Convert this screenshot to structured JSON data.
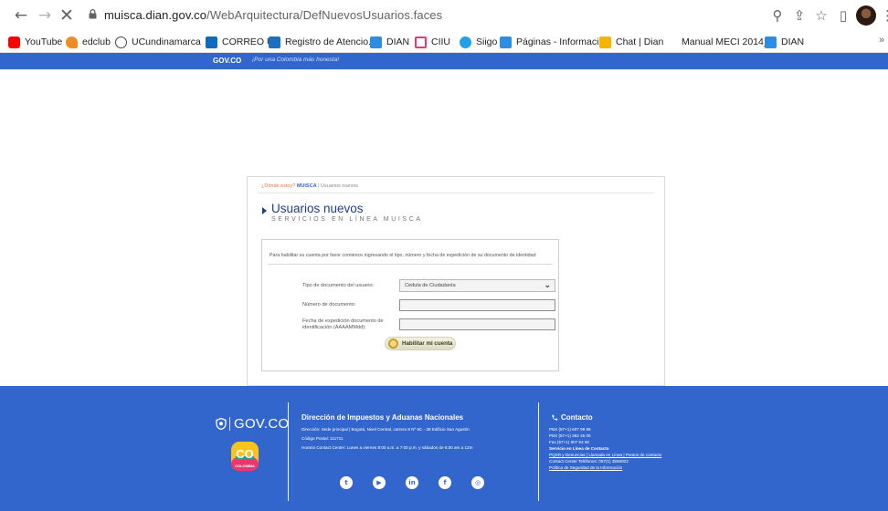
{
  "browser": {
    "url_host": "muisca.dian.gov.co",
    "url_path": "/WebArquitectura/DefNuevosUsuarios.faces",
    "icons": [
      "back-icon",
      "forward-icon",
      "close-icon",
      "lock-icon",
      "zoom-icon",
      "share-icon",
      "star-icon",
      "sidepanel-icon",
      "profile-avatar",
      "menu-icon"
    ]
  },
  "bookmarks": [
    {
      "label": "YouTube",
      "color": "#ff0000"
    },
    {
      "label": "edclub",
      "color": "#f08a24"
    },
    {
      "label": "UCundinamarca",
      "color": "#444444"
    },
    {
      "label": "CORREO U",
      "color": "#0f6cbd"
    },
    {
      "label": "Registro de Atencio...",
      "color": "#1f6fbf"
    },
    {
      "label": "DIAN",
      "color": "#2d8de0"
    },
    {
      "label": "CIIU",
      "color": "#e8386d"
    },
    {
      "label": "Siigo",
      "color": "#23a0e8"
    },
    {
      "label": "Páginas - Informaci...",
      "color": "#2d8de0"
    },
    {
      "label": "Chat | Dian",
      "color": "#f5b400"
    },
    {
      "label": "Manual MECI 2014_...",
      "color": ""
    },
    {
      "label": "DIAN",
      "color": "#2d8de0"
    }
  ],
  "bookmarks_more": "»",
  "govbar": {
    "badge": "GOV.CO",
    "slogan": "¡Por una Colombia más honesta!"
  },
  "panel": {
    "breadcrumb_prefix": "¿Dónde estoy?",
    "breadcrumb_home": "MUISCA",
    "breadcrumb_sep": " | ",
    "breadcrumb_current": "Usuarios nuevos",
    "title": "Usuarios nuevos",
    "subtitle": "SERVICIOS EN LÍNEA MUISCA",
    "intro": "Para habilitar su cuenta por favor comience ingresando el tipo, número y fecha de expedición de su documento de identidad",
    "doc_type_label": "Tipo de documento del usuario:",
    "doc_type_value": "Cédula de Ciudadanía",
    "doc_number_label": "Número de documento:",
    "doc_number_value": "",
    "exp_date_label_1": "Fecha de expedición documento de",
    "exp_date_label_2": "identificación (AAAAMMdd):",
    "exp_date_value": "",
    "submit_label": "Habilitar mi cuenta"
  },
  "footer": {
    "gov_logo": "GOV.CO",
    "co_logo": "CO",
    "co_sub": "COLOMBIA",
    "org_title": "Dirección de Impuestos y Aduanas Nacionales",
    "address": "Dirección: Sede principal | Bogotá, Nivel Central, carrera 8 Nº 6C - 38 Edificio San Agustín",
    "postal": "Código Postal: 111711",
    "hours": "Horario Contact Center: Lunes a viernes 8:00 a.m. a 7:00 p.m. y sábados de 8:00 am a 12m",
    "socials": [
      "twitter-icon",
      "youtube-icon",
      "linkedin-icon",
      "facebook-icon",
      "instagram-icon"
    ],
    "social_glyphs": [
      "t",
      "▶",
      "in",
      "f",
      "◎"
    ],
    "contact_title": "Contacto",
    "pbx1": "PBX (57+1) 607 99 99",
    "pbx2": "PBX (57+1) 382 45 00",
    "fax": "Fax (57+1) 607 94 50",
    "online_title": "Servicio en Línea de Contacto",
    "links": "PQSR y Denuncias | Llamada en Línea | Puntos de contacto",
    "contact_center": "Contact Center Teléfonos: 057(1) 3556922",
    "privacy": "Política de Seguridad de la Información"
  }
}
